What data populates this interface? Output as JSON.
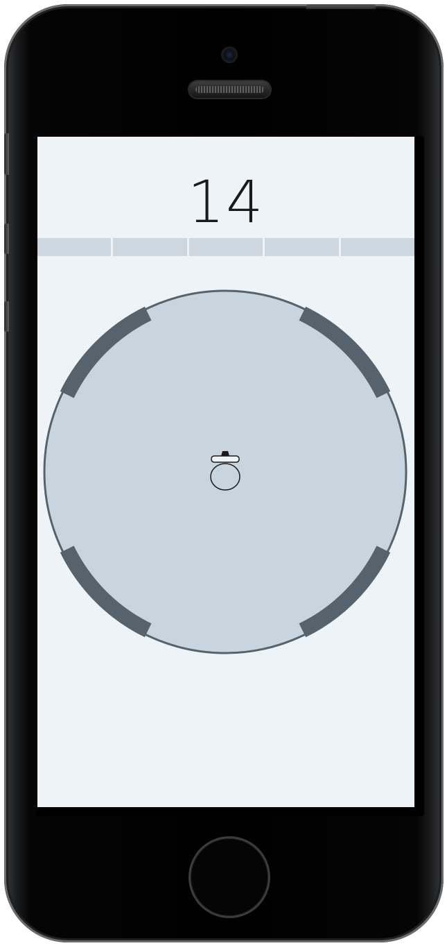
{
  "game": {
    "score": "14",
    "progress": {
      "segments": 5,
      "filled": 0
    },
    "colors": {
      "background": "#eef3f7",
      "board_fill": "#c9d5de",
      "board_edge": "#56626c",
      "wall": "#56626c",
      "progress_segment": "#ccd7e0",
      "text": "#1a1a1a"
    },
    "walls": [
      "top-left",
      "top-right",
      "bottom-left",
      "bottom-right"
    ],
    "player": {
      "icon": "ball-with-hat-icon"
    }
  }
}
